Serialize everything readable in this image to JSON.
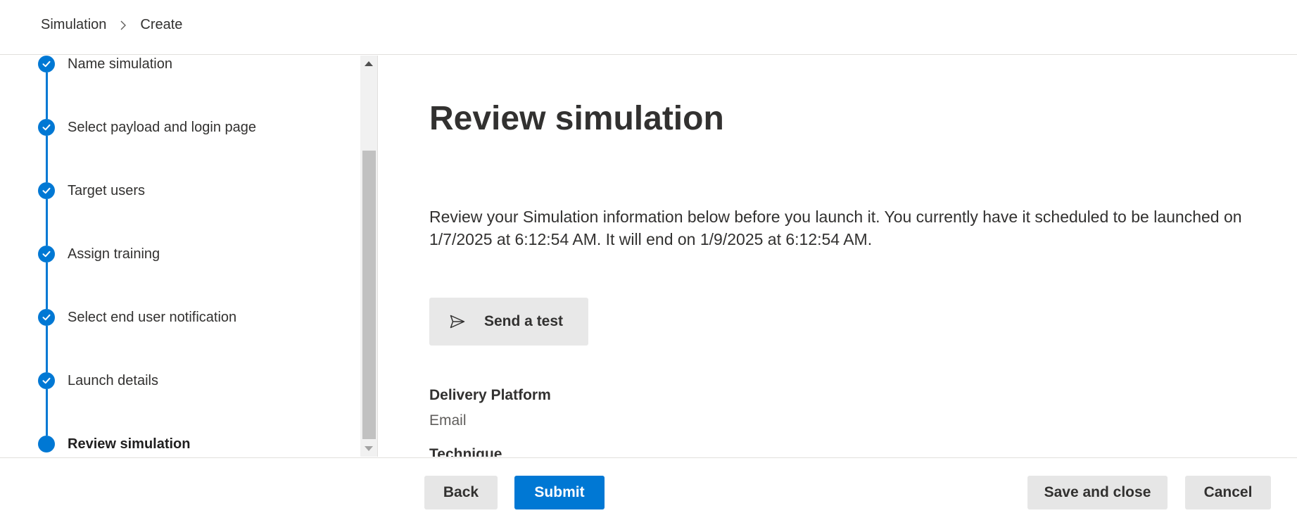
{
  "breadcrumb": {
    "items": [
      "Simulation",
      "Create"
    ]
  },
  "wizard": {
    "steps": [
      {
        "label": "Name simulation",
        "status": "complete"
      },
      {
        "label": "Select payload and login page",
        "status": "complete"
      },
      {
        "label": "Target users",
        "status": "complete"
      },
      {
        "label": "Assign training",
        "status": "complete"
      },
      {
        "label": "Select end user notification",
        "status": "complete"
      },
      {
        "label": "Launch details",
        "status": "complete"
      },
      {
        "label": "Review simulation",
        "status": "current"
      }
    ]
  },
  "main": {
    "title": "Review simulation",
    "description": "Review your Simulation information below before you launch it. You currently have it scheduled to be launched on 1/7/2025 at 6:12:54 AM. It will end on 1/9/2025 at 6:12:54 AM.",
    "send_test_label": "Send a test",
    "send_test_icon": "send-icon",
    "fields": [
      {
        "label": "Delivery Platform",
        "value": "Email"
      },
      {
        "label": "Technique",
        "value": ""
      }
    ]
  },
  "footer": {
    "back_label": "Back",
    "submit_label": "Submit",
    "save_close_label": "Save and close",
    "cancel_label": "Cancel"
  },
  "colors": {
    "accent": "#0078d4",
    "secondary_button": "#e6e6e6",
    "text": "#323130"
  }
}
